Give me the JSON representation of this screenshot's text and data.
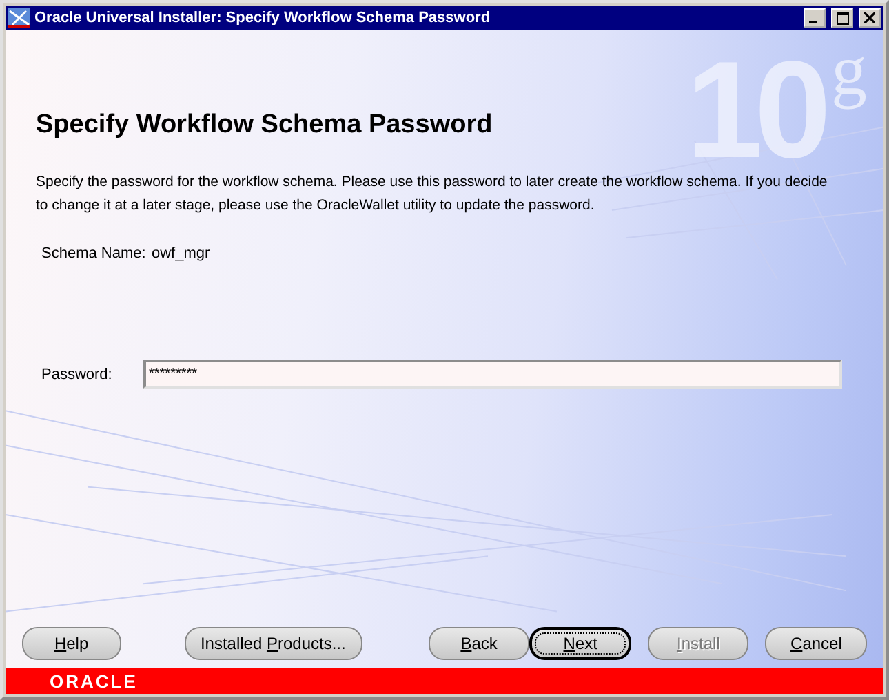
{
  "window": {
    "title": "Oracle Universal Installer: Specify Workflow Schema Password"
  },
  "logo": {
    "number": "10",
    "letter": "g"
  },
  "page": {
    "heading": "Specify Workflow Schema Password",
    "description": "Specify the password for the workflow schema. Please use this password to later create the workflow schema. If you decide to change it at a later stage, please use the OracleWallet utility to update the password."
  },
  "schema": {
    "label": "Schema Name:",
    "value": "owf_mgr"
  },
  "password": {
    "label": "Password:",
    "value": "*********"
  },
  "buttons": [
    {
      "label": [
        {
          "text": "H",
          "underline": true
        },
        {
          "text": "elp",
          "underline": false
        }
      ],
      "disabled": false,
      "default": false
    },
    {
      "label": [
        {
          "text": "Installed ",
          "underline": false
        },
        {
          "text": "P",
          "underline": true
        },
        {
          "text": "roducts...",
          "underline": false
        }
      ],
      "disabled": false,
      "default": false
    },
    {
      "label": [
        {
          "text": "B",
          "underline": true
        },
        {
          "text": "ack",
          "underline": false
        }
      ],
      "disabled": false,
      "default": false
    },
    {
      "label": [
        {
          "text": "N",
          "underline": true
        },
        {
          "text": "ext",
          "underline": false
        }
      ],
      "disabled": false,
      "default": true
    },
    {
      "label": [
        {
          "text": "I",
          "underline": true
        },
        {
          "text": "nstall",
          "underline": false
        }
      ],
      "disabled": true,
      "default": false
    },
    {
      "label": [
        {
          "text": "C",
          "underline": true
        },
        {
          "text": "ancel",
          "underline": false
        }
      ],
      "disabled": false,
      "default": false
    }
  ],
  "brand_bar": {
    "text": "ORACLE"
  }
}
